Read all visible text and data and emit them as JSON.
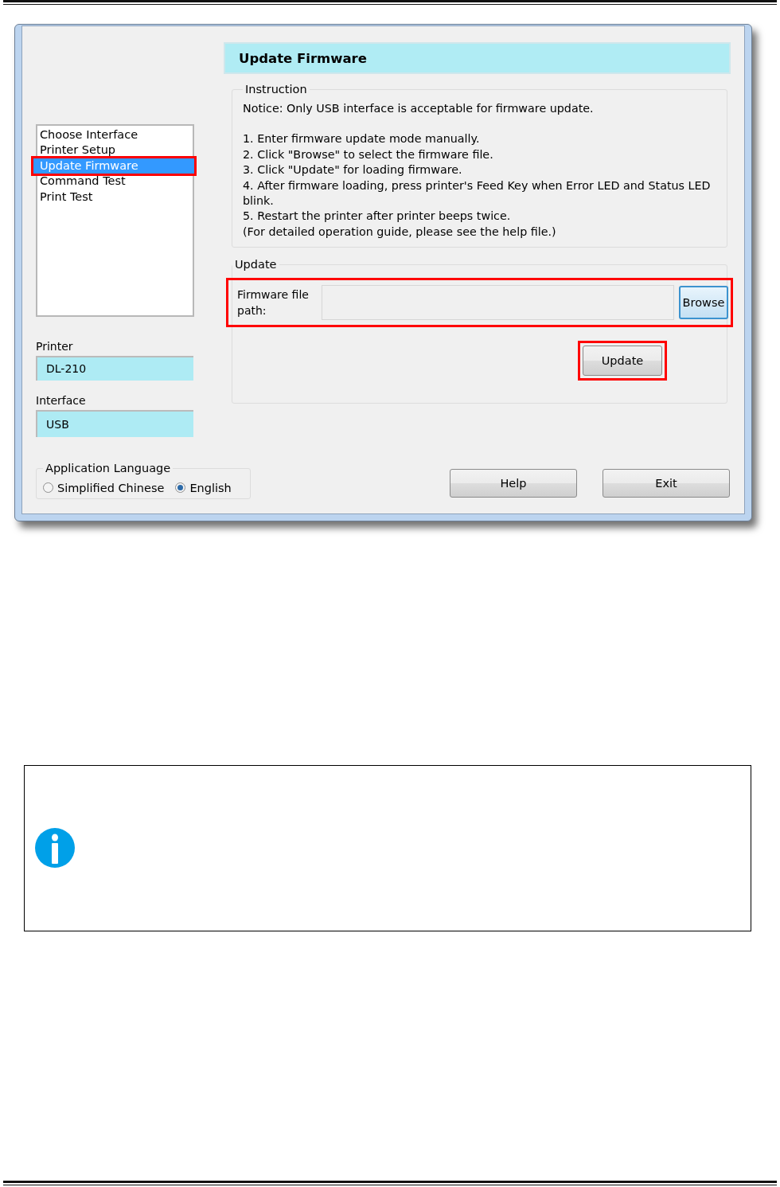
{
  "window": {
    "page_title": "Update Firmware",
    "nav_list": [
      {
        "label": "Choose Interface",
        "selected": false,
        "highlighted": false
      },
      {
        "label": "Printer Setup",
        "selected": false,
        "highlighted": false
      },
      {
        "label": "Update Firmware",
        "selected": true,
        "highlighted": true
      },
      {
        "label": "Command Test",
        "selected": false,
        "highlighted": false
      },
      {
        "label": "Print Test",
        "selected": false,
        "highlighted": false
      }
    ],
    "printer": {
      "label": "Printer",
      "value": "DL-210"
    },
    "interface": {
      "label": "Interface",
      "value": "USB"
    },
    "language": {
      "legend": "Application Language",
      "options": [
        {
          "label": "Simplified Chinese",
          "selected": false
        },
        {
          "label": "English",
          "selected": true
        }
      ]
    },
    "instruction": {
      "legend": "Instruction",
      "notice": "Notice: Only USB interface is acceptable for firmware update.",
      "steps": [
        "1. Enter firmware update mode manually.",
        "2. Click \"Browse\" to select the firmware file.",
        "3. Click  \"Update\" for loading firmware.",
        "4. After firmware loading, press printer's Feed Key when Error LED and Status LED blink.",
        "5. Restart the printer after printer beeps twice.",
        "(For detailed operation guide, please see the help file.)"
      ]
    },
    "update": {
      "legend": "Update",
      "field_label": "Firmware file path:",
      "field_highlighted": true,
      "browse_button": "Browse",
      "update_button": {
        "label": "Update",
        "highlighted": true
      }
    },
    "buttons": [
      "Help",
      "Exit"
    ]
  }
}
